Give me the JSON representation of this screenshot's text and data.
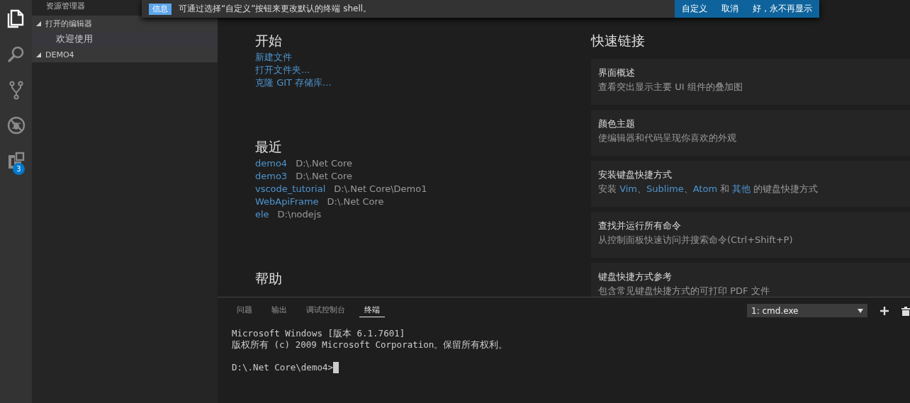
{
  "activity_bar": {
    "items": [
      {
        "kind": "files",
        "selected": true
      },
      {
        "kind": "search",
        "selected": false
      },
      {
        "kind": "source-control",
        "selected": false
      },
      {
        "kind": "debug",
        "selected": false
      },
      {
        "kind": "extensions",
        "selected": false,
        "badge": "3"
      }
    ]
  },
  "sidebar": {
    "title": "资源管理器",
    "sections": [
      {
        "label": "打开的编辑器",
        "expanded": true,
        "items": [
          {
            "label": "欢迎使用",
            "selected": true
          }
        ]
      },
      {
        "label": "DEMO4",
        "expanded": true
      }
    ]
  },
  "notification": {
    "severity": "信息",
    "message": "可通过选择“自定义”按钮来更改默认的终端 shell。",
    "actions": [
      "自定义",
      "取消",
      "好，永不再显示"
    ]
  },
  "welcome": {
    "start": {
      "title": "开始",
      "links": [
        "新建文件",
        "打开文件夹...",
        "克隆 GIT 存储库..."
      ]
    },
    "recent": {
      "title": "最近",
      "items": [
        {
          "name": "demo4",
          "path": "D:\\.Net Core"
        },
        {
          "name": "demo3",
          "path": "D:\\.Net Core"
        },
        {
          "name": "vscode_tutorial",
          "path": "D:\\.Net Core\\Demo1"
        },
        {
          "name": "WebApiFrame",
          "path": "D:\\.Net Core"
        },
        {
          "name": "ele",
          "path": "D:\\nodejs"
        }
      ]
    },
    "help": {
      "title": "帮助"
    },
    "quick_links": {
      "title": "快速链接",
      "cards": [
        {
          "title": "界面概述",
          "description": [
            {
              "text": "查看突出显示主要 UI 组件的叠加图",
              "link": false
            }
          ]
        },
        {
          "title": "颜色主题",
          "description": [
            {
              "text": "使编辑器和代码呈现你喜欢的外观",
              "link": false
            }
          ]
        },
        {
          "title": "安装键盘快捷方式",
          "description": [
            {
              "text": "安装 ",
              "link": false
            },
            {
              "text": "Vim",
              "link": true
            },
            {
              "text": "、",
              "link": false
            },
            {
              "text": "Sublime",
              "link": true
            },
            {
              "text": "、",
              "link": false
            },
            {
              "text": "Atom",
              "link": true
            },
            {
              "text": " 和 ",
              "link": false
            },
            {
              "text": "其他",
              "link": true
            },
            {
              "text": " 的键盘快捷方式",
              "link": false
            }
          ]
        },
        {
          "title": "查找并运行所有命令",
          "description": [
            {
              "text": "从控制面板快速访问并搜索命令(Ctrl+Shift+P)",
              "link": false
            }
          ]
        },
        {
          "title": "键盘快捷方式参考",
          "description": [
            {
              "text": "包含常见键盘快捷方式的可打印 PDF 文件",
              "link": false
            }
          ]
        }
      ]
    }
  },
  "panel": {
    "tabs": [
      {
        "label": "问题",
        "selected": false
      },
      {
        "label": "输出",
        "selected": false
      },
      {
        "label": "调试控制台",
        "selected": false
      },
      {
        "label": "终端",
        "selected": true
      }
    ],
    "terminal_select": "1: cmd.exe",
    "output_lines": [
      "Microsoft Windows [版本 6.1.7601]",
      "版权所有 (c) 2009 Microsoft Corporation。保留所有权利。"
    ],
    "prompt": "D:\\.Net Core\\demo4>"
  }
}
